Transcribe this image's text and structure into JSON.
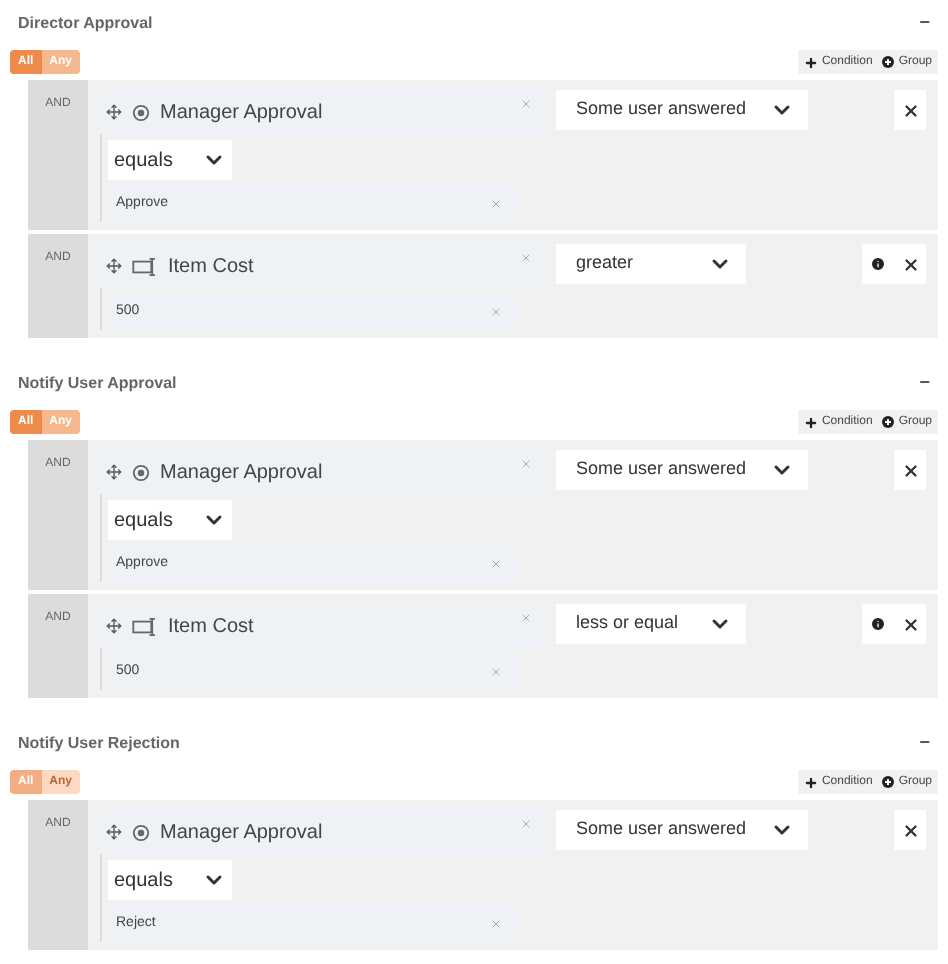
{
  "sections": [
    {
      "title": "Director Approval",
      "collapse": "−",
      "disabled": false,
      "toggle": [
        {
          "label": "All",
          "selected": true
        },
        {
          "label": "Any",
          "selected": false
        }
      ],
      "actions": [
        {
          "kind": "condition",
          "label": "Condition"
        },
        {
          "kind": "group",
          "label": "Group"
        }
      ],
      "rows": [
        {
          "join": "AND",
          "kind": "radio",
          "field": "Manager Approval",
          "operator": "Some user answered",
          "comparison": "equals",
          "value": "Approve",
          "info": false
        },
        {
          "join": "AND",
          "kind": "input",
          "field": "Item Cost",
          "operator": "greater",
          "value": "500",
          "info": true
        }
      ]
    },
    {
      "title": "Notify User Approval",
      "collapse": "−",
      "disabled": false,
      "toggle": [
        {
          "label": "All",
          "selected": true
        },
        {
          "label": "Any",
          "selected": false
        }
      ],
      "actions": [
        {
          "kind": "condition",
          "label": "Condition"
        },
        {
          "kind": "group",
          "label": "Group"
        }
      ],
      "rows": [
        {
          "join": "AND",
          "kind": "radio",
          "field": "Manager Approval",
          "operator": "Some user answered",
          "comparison": "equals",
          "value": "Approve",
          "info": false
        },
        {
          "join": "AND",
          "kind": "input",
          "field": "Item Cost",
          "operator": "less or equal",
          "value": "500",
          "info": true
        }
      ]
    },
    {
      "title": "Notify User Rejection",
      "collapse": "−",
      "disabled": true,
      "toggle": [
        {
          "label": "All",
          "selected": true
        },
        {
          "label": "Any",
          "selected": false
        }
      ],
      "actions": [
        {
          "kind": "condition",
          "label": "Condition"
        },
        {
          "kind": "group",
          "label": "Group"
        }
      ],
      "rows": [
        {
          "join": "AND",
          "kind": "radio",
          "field": "Manager Approval",
          "operator": "Some user answered",
          "comparison": "equals",
          "value": "Reject",
          "info": false
        }
      ]
    }
  ]
}
